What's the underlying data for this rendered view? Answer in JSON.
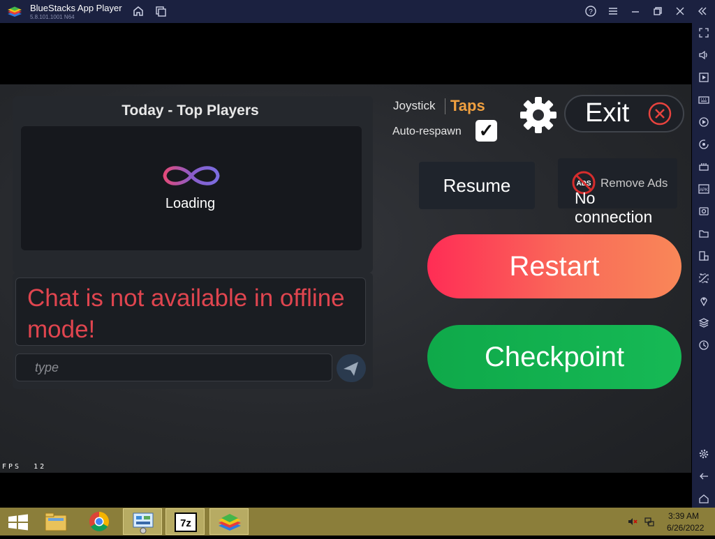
{
  "window": {
    "title": "BlueStacks App Player",
    "version": "5.8.101.1001 N64"
  },
  "titlebar_icons": [
    "home-icon",
    "multi-instance-icon",
    "help-icon",
    "menu-icon",
    "minimize-icon",
    "restore-icon",
    "close-icon",
    "collapse-sidebar-icon"
  ],
  "sidebar_icons": [
    "fullscreen-icon",
    "volume-icon",
    "media-icon",
    "keyboard-icon",
    "macro-icon",
    "rotate-icon",
    "controls-icon",
    "apk-icon",
    "screenshot-icon",
    "folder-icon",
    "multi-window-icon",
    "eco-mode-icon",
    "location-icon",
    "layers-icon",
    "sync-icon",
    "settings-icon",
    "back-icon",
    "home-icon"
  ],
  "game": {
    "leaderboard": {
      "title": "Today - Top Players",
      "loading": "Loading"
    },
    "chat": {
      "message": "Chat is not available in offline mode!",
      "input_placeholder": "type"
    },
    "mode": {
      "joystick": "Joystick",
      "taps": "Taps"
    },
    "auto_respawn": {
      "label": "Auto-respawn",
      "checked": true,
      "check_mark": "✓"
    },
    "exit": {
      "label": "Exit"
    },
    "resume": {
      "label": "Resume"
    },
    "remove_ads": {
      "label": "Remove Ads",
      "status": "No connection",
      "icon_text": "ADS"
    },
    "restart": {
      "label": "Restart"
    },
    "checkpoint": {
      "label": "Checkpoint"
    },
    "fps": {
      "label": "FPS",
      "value": "12"
    }
  },
  "taskbar": {
    "apps": [
      "start-icon",
      "file-explorer-icon",
      "chrome-icon",
      "control-panel-icon",
      "7zip-icon",
      "bluestacks-icon"
    ],
    "seven_zip_text": "7z",
    "clock": {
      "time": "3:39 AM",
      "date": "6/26/2022"
    }
  },
  "colors": {
    "titlebar": "#1b2140",
    "taps_accent": "#f0a040",
    "chat_error": "#e0454f",
    "restart": "#ff2d55",
    "checkpoint": "#16b955",
    "taskbar": "#8b7e3a"
  }
}
